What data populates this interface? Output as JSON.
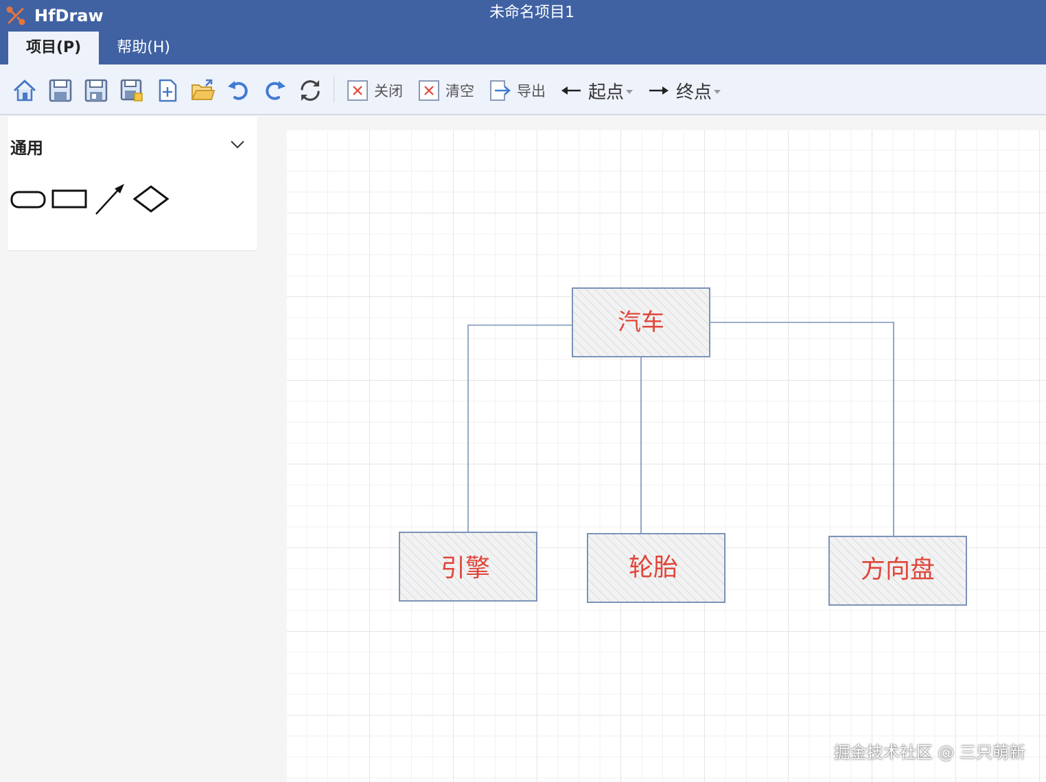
{
  "app": {
    "name": "HfDraw",
    "window_title": "未命名项目1"
  },
  "menu": {
    "tabs": [
      {
        "label": "项目(P)"
      },
      {
        "label": "帮助(H)"
      }
    ]
  },
  "toolbar": {
    "icons": [
      "home-icon",
      "save-icon",
      "save-as-icon",
      "save-all-icon",
      "new-file-icon",
      "open-folder-icon",
      "undo-icon",
      "redo-icon",
      "refresh-icon"
    ],
    "close_label": "关闭",
    "clear_label": "清空",
    "export_label": "导出",
    "start_label": "起点",
    "end_label": "终点"
  },
  "panel": {
    "title": "通用",
    "shapes": [
      "rounded-rect-shape",
      "rect-shape",
      "arrow-shape",
      "diamond-shape"
    ]
  },
  "diagram": {
    "nodes": {
      "car": "汽车",
      "engine": "引擎",
      "tire": "轮胎",
      "wheel": "方向盘"
    },
    "edges": [
      [
        "car",
        "engine"
      ],
      [
        "car",
        "tire"
      ],
      [
        "car",
        "wheel"
      ]
    ]
  },
  "watermark": "掘金技术社区 @ 三只萌新",
  "colors": {
    "titlebar": "#4062a3",
    "toolbar": "#eef2fb",
    "node_border": "#7b93b8",
    "node_text": "#e0463a"
  }
}
